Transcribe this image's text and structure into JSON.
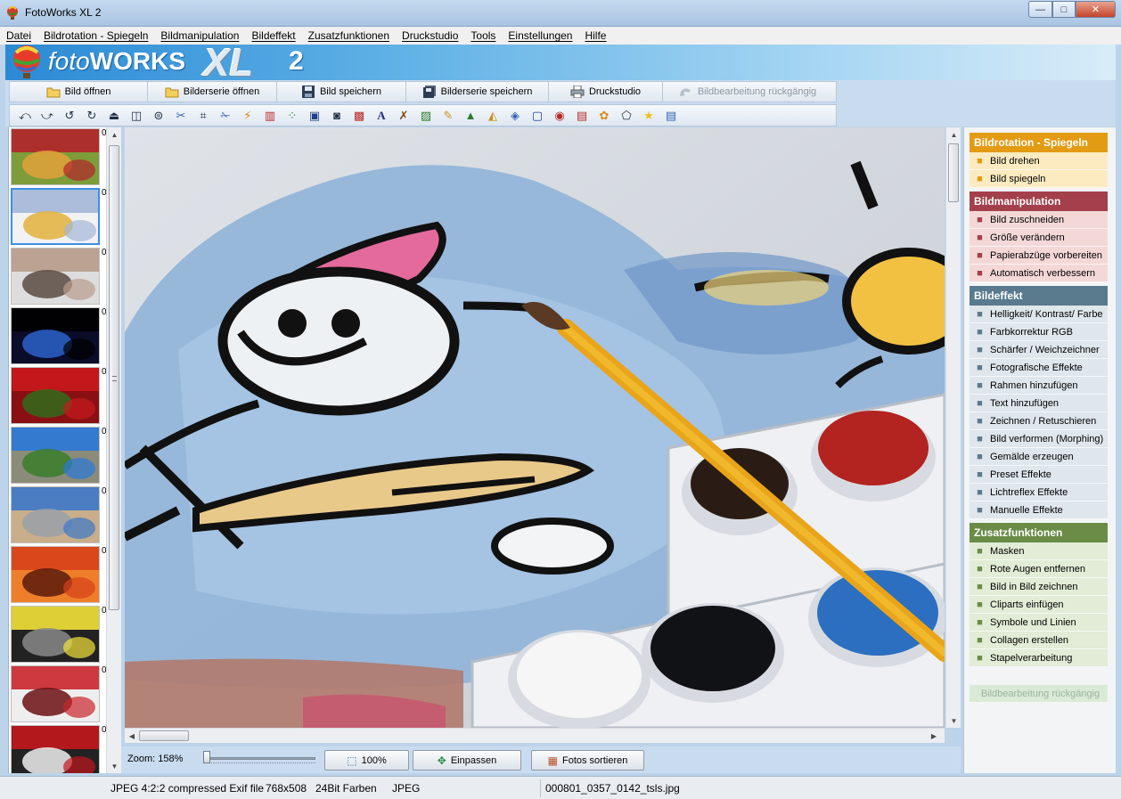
{
  "window": {
    "title": "FotoWorks XL 2",
    "minimize_label": "—",
    "maximize_label": "□",
    "close_label": "✕"
  },
  "menu": [
    {
      "label": "Datei"
    },
    {
      "label": "Bildrotation - Spiegeln"
    },
    {
      "label": "Bildmanipulation"
    },
    {
      "label": "Bildeffekt"
    },
    {
      "label": "Zusatzfunktionen"
    },
    {
      "label": "Druckstudio"
    },
    {
      "label": "Tools"
    },
    {
      "label": "Einstellungen"
    },
    {
      "label": "Hilfe"
    }
  ],
  "banner": {
    "logo_foto": "foto",
    "logo_works": "WORKS",
    "logo_xl": "XL",
    "logo_version": "2"
  },
  "toolbar": {
    "open_image": "Bild öffnen",
    "open_series": "Bilderserie öffnen",
    "save_image": "Bild speichern",
    "save_series": "Bilderserie speichern",
    "print_studio": "Druckstudio",
    "undo": "Bildbearbeitung rückgängig"
  },
  "tools": [
    "rotate-left-icon",
    "rotate-right-icon",
    "rotate-ccw-icon",
    "rotate-cw-icon",
    "flip-icon",
    "mirror-icon",
    "mirror-vertical-icon",
    "scissors-icon",
    "resize-icon",
    "paper-scissors-icon",
    "magic-wand-icon",
    "brightness-icon",
    "color-rgb-icon",
    "sharpen-icon",
    "camera-icon",
    "frame-icon",
    "text-icon",
    "draw-icon",
    "morph-icon",
    "painting-icon",
    "preset-icon",
    "lens-flare-icon",
    "manual-effect-icon",
    "mask-icon",
    "red-eye-icon",
    "picture-in-picture-icon",
    "clipart-icon",
    "symbols-icon",
    "star-icon",
    "batch-icon"
  ],
  "thumbnails": {
    "count_label": "0",
    "items": [
      {
        "name": "fruit-basket",
        "colors": [
          "#b3232b",
          "#7e9d3a",
          "#e0a23a"
        ]
      },
      {
        "name": "watercolor-painting",
        "colors": [
          "#a3b7d8",
          "#f2f2f2",
          "#e3b23c"
        ]
      },
      {
        "name": "conference-room",
        "colors": [
          "#b89b8a",
          "#ddd",
          "#5b4b43"
        ]
      },
      {
        "name": "moon-earth",
        "colors": [
          "#000",
          "#0b0b2a",
          "#2a62c9"
        ]
      },
      {
        "name": "strawberries",
        "colors": [
          "#c8191d",
          "#8a0f12",
          "#2f6b1b"
        ]
      },
      {
        "name": "castle",
        "colors": [
          "#2a78d8",
          "#8b8b7a",
          "#3a7d2a"
        ]
      },
      {
        "name": "bridge-city",
        "colors": [
          "#3c78c7",
          "#c9ae8b",
          "#9aa0a8"
        ]
      },
      {
        "name": "plane-sunset",
        "colors": [
          "#d6421a",
          "#ef7e2b",
          "#5a1a0a"
        ]
      },
      {
        "name": "yellow-car",
        "colors": [
          "#f4e23a",
          "#222",
          "#888"
        ]
      },
      {
        "name": "red-car-interior",
        "colors": [
          "#c9252b",
          "#eee",
          "#6b0f12"
        ]
      },
      {
        "name": "red-car",
        "colors": [
          "#c2171c",
          "#222",
          "#eee"
        ]
      }
    ]
  },
  "zoom": {
    "label": "Zoom: 158%",
    "level": 0.0,
    "btn_100": "100%",
    "btn_fit": "Einpassen",
    "btn_sort": "Fotos sortieren"
  },
  "panel": {
    "sections": [
      {
        "title": "Bildrotation - Spiegeln",
        "color": "#e39b14",
        "item_bg": "#fcebc0",
        "items": [
          {
            "label": "Bild drehen",
            "icon": "rotate-image-icon"
          },
          {
            "label": "Bild spiegeln",
            "icon": "mirror-image-icon"
          }
        ]
      },
      {
        "title": "Bildmanipulation",
        "color": "#a3404b",
        "item_bg": "#f4d8d8",
        "items": [
          {
            "label": "Bild zuschneiden",
            "icon": "crop-icon"
          },
          {
            "label": "Größe verändern",
            "icon": "resize-icon"
          },
          {
            "label": "Papierabzüge vorbereiten",
            "icon": "print-prep-icon"
          },
          {
            "label": "Automatisch verbessern",
            "icon": "auto-enhance-icon"
          }
        ]
      },
      {
        "title": "Bildeffekt",
        "color": "#5a7a8e",
        "item_bg": "#dfe6ec",
        "items": [
          {
            "label": "Helligkeit/ Kontrast/ Farbe",
            "icon": "brightness-icon"
          },
          {
            "label": "Farbkorrektur RGB",
            "icon": "rgb-icon"
          },
          {
            "label": "Schärfer / Weichzeichner",
            "icon": "sharpen-icon"
          },
          {
            "label": "Fotografische Effekte",
            "icon": "photo-effects-icon"
          },
          {
            "label": "Rahmen hinzufügen",
            "icon": "frame-icon"
          },
          {
            "label": "Text hinzufügen",
            "icon": "text-icon"
          },
          {
            "label": "Zeichnen / Retuschieren",
            "icon": "draw-icon"
          },
          {
            "label": "Bild verformen (Morphing)",
            "icon": "morph-icon"
          },
          {
            "label": "Gemälde erzeugen",
            "icon": "painting-icon"
          },
          {
            "label": "Preset Effekte",
            "icon": "preset-icon"
          },
          {
            "label": "Lichtreflex Effekte",
            "icon": "lens-flare-icon"
          },
          {
            "label": "Manuelle Effekte",
            "icon": "manual-effects-icon"
          }
        ]
      },
      {
        "title": "Zusatzfunktionen",
        "color": "#6b8c47",
        "item_bg": "#e2ecd6",
        "items": [
          {
            "label": "Masken",
            "icon": "mask-icon"
          },
          {
            "label": "Rote Augen entfernen",
            "icon": "red-eye-icon"
          },
          {
            "label": "Bild in Bild zeichnen",
            "icon": "pip-icon"
          },
          {
            "label": "Cliparts einfügen",
            "icon": "clipart-icon"
          },
          {
            "label": "Symbole und Linien",
            "icon": "symbols-icon"
          },
          {
            "label": "Collagen erstellen",
            "icon": "collage-icon"
          },
          {
            "label": "Stapelverarbeitung",
            "icon": "batch-icon"
          }
        ]
      }
    ],
    "undo_label": "Bildbearbeitung rückgängig"
  },
  "status": {
    "format": "JPEG 4:2:2 compressed Exif file",
    "dimensions": "768x508",
    "color_depth": "24Bit Farben",
    "type": "JPEG",
    "filename": "000801_0357_0142_tsls.jpg"
  }
}
